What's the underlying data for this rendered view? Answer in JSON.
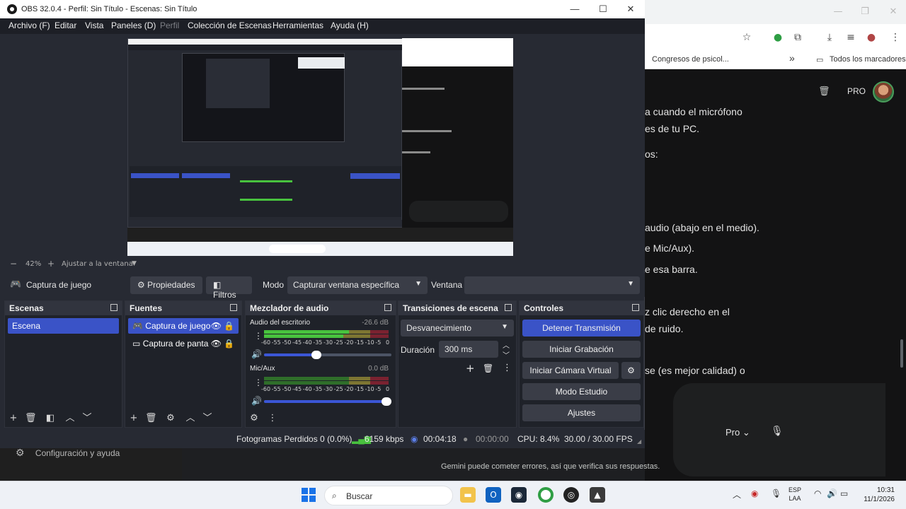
{
  "browser": {
    "bookmarks": {
      "folder1": "Congresos de psicol...",
      "more": "»",
      "all_bookmarks": "Todos los marcadores"
    },
    "gemini": {
      "pro_label": "PRO",
      "lines": [
        "a cuando el micrófono",
        "es de tu PC.",
        "os:",
        "audio (abajo en el medio).",
        "e Mic/Aux).",
        "e esa barra.",
        "z clic derecho en el",
        "de ruido.",
        "se (es mejor calidad) o"
      ],
      "model_select": "Pro",
      "disclaimer": "Gemini puede cometer errores, así que verifica sus respuestas."
    },
    "settings_link": "Configuración y ayuda"
  },
  "obs": {
    "title": "OBS 32.0.4 - Perfil: Sin Título - Escenas: Sin Título",
    "menu": {
      "archivo": "Archivo (F)",
      "editar": "Editar",
      "vista": "Vista",
      "paneles": "Paneles (D)",
      "perfil": "Perfil",
      "coleccion": "Colección de Escenas",
      "herramientas": "Herramientas",
      "ayuda": "Ayuda (H)"
    },
    "preview": {
      "zoom_minus": "−",
      "zoom_level": "42%",
      "zoom_plus": "+",
      "fit_label": "Ajustar a la ventana"
    },
    "source_toolbar": {
      "source_name": "Captura de juego",
      "properties": "Propiedades",
      "filters": "Filtros",
      "mode_label": "Modo",
      "mode_value": "Capturar ventana específica",
      "window_label": "Ventana",
      "window_value": ""
    },
    "scenes": {
      "title": "Escenas",
      "items": [
        "Escena"
      ]
    },
    "sources": {
      "title": "Fuentes",
      "items": [
        "Captura de juego",
        "Captura de panta"
      ]
    },
    "mixer": {
      "title": "Mezclador de audio",
      "channels": [
        {
          "name": "Audio del escritorio",
          "db": "-26.6 dB",
          "volume_pct": 41
        },
        {
          "name": "Mic/Aux",
          "db": "0.0 dB",
          "volume_pct": 100
        }
      ],
      "scale": [
        "-60",
        "-55",
        "-50",
        "-45",
        "-40",
        "-35",
        "-30",
        "-25",
        "-20",
        "-15",
        "-10",
        "-5",
        "0"
      ]
    },
    "transitions": {
      "title": "Transiciones de escena",
      "type": "Desvanecimiento",
      "duration_label": "Duración",
      "duration_value": "300 ms"
    },
    "controls": {
      "title": "Controles",
      "stop_stream": "Detener Transmisión",
      "start_record": "Iniciar Grabación",
      "virtual_cam": "Iniciar Cámara Virtual",
      "studio_mode": "Modo Estudio",
      "settings": "Ajustes"
    },
    "status": {
      "dropped_frames": "Fotogramas Perdidos 0 (0.0%)",
      "bitrate": "6159 kbps",
      "stream_time": "00:04:18",
      "record_time": "00:00:00",
      "cpu": "CPU: 8.4%",
      "fps": "30.00 / 30.00 FPS"
    }
  },
  "taskbar": {
    "search_placeholder": "Buscar",
    "lang_line1": "ESP",
    "lang_line2": "LAA",
    "time": "10:31",
    "date": "11/1/2026"
  },
  "colors": {
    "obs_accent": "#3a53c7",
    "meter_green": "#48c23e",
    "meter_yellow": "#bfae37",
    "meter_red": "#c8283c"
  }
}
